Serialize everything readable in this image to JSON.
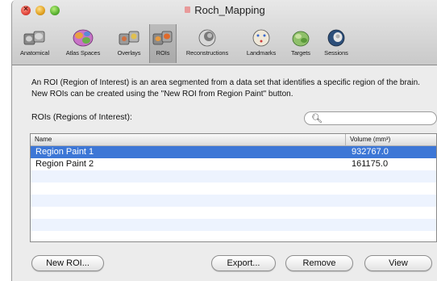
{
  "window": {
    "title": "Roch_Mapping"
  },
  "tabs": [
    {
      "label": "Anatomical"
    },
    {
      "label": "Atlas Spaces"
    },
    {
      "label": "Overlays"
    },
    {
      "label": "ROIs",
      "selected": true
    },
    {
      "label": "Reconstructions"
    },
    {
      "label": "Landmarks"
    },
    {
      "label": "Targets"
    },
    {
      "label": "Sessions"
    }
  ],
  "description": "An ROI (Region of Interest) is an area segmented from a data set that identifies a specific region of the brain. New ROIs can be created using the \"New ROI from Region Paint\" button.",
  "rois_label": "ROIs (Regions of Interest):",
  "search": {
    "value": "",
    "icon": "search-icon"
  },
  "table": {
    "headers": {
      "name": "Name",
      "volume": "Volume (mm³)"
    },
    "rows": [
      {
        "name": "Region Paint 1",
        "volume": "932767.0",
        "selected": true
      },
      {
        "name": "Region Paint 2",
        "volume": "161175.0",
        "selected": false
      }
    ]
  },
  "buttons": {
    "new_roi": "New ROI...",
    "export": "Export...",
    "remove": "Remove",
    "view": "View"
  },
  "colors": {
    "selection": "#3d77d6",
    "alternate_row": "#edf3fe"
  }
}
